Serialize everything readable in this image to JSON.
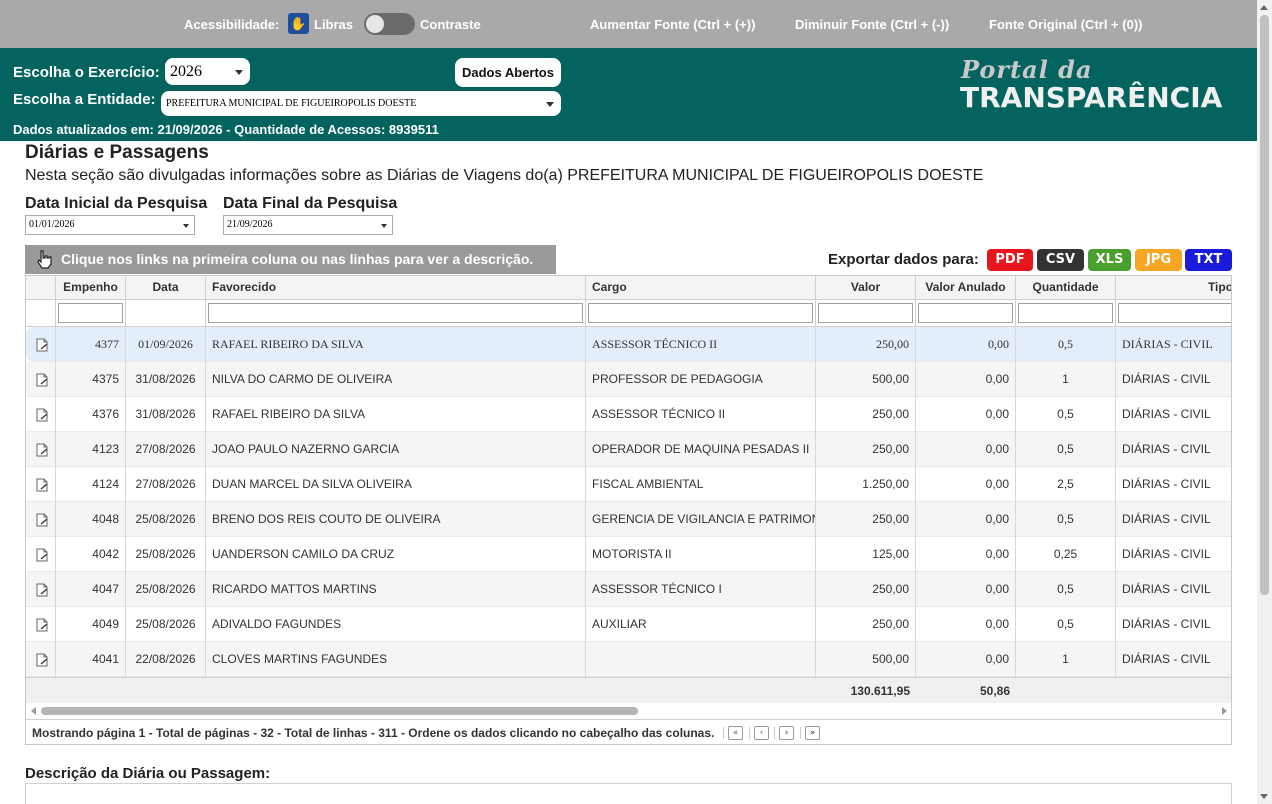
{
  "accessibility": {
    "label": "Acessibilidade:",
    "libras": "Libras",
    "contrast": "Contraste",
    "increase_font": "Aumentar Fonte (Ctrl + (+))",
    "decrease_font": "Diminuir Fonte (Ctrl + (-))",
    "original_font": "Fonte Original (Ctrl + (0))"
  },
  "header": {
    "exercise_label": "Escolha o Exercício:",
    "exercise_value": "2026",
    "entity_label": "Escolha a Entidade:",
    "entity_value": "PREFEITURA MUNICIPAL DE FIGUEIROPOLIS DOESTE",
    "open_data_button": "Dados Abertos",
    "updated_text": "Dados atualizados em: 21/09/2026 - Quantidade de Acessos: 8939511",
    "logo_line1": "Portal da",
    "logo_line2": "TRANSPARÊNCIA",
    "bg_color": "#03635f"
  },
  "page": {
    "title": "Diárias e Passagens",
    "description": "Nesta seção são divulgadas informações sobre as Diárias de Viagens do(a) PREFEITURA MUNICIPAL DE FIGUEIROPOLIS DOESTE",
    "start_date_label": "Data Inicial da Pesquisa",
    "start_date_value": "01/01/2026",
    "end_date_label": "Data Final da Pesquisa",
    "end_date_value": "21/09/2026",
    "hint": "Clique nos links na primeira coluna ou nas linhas para ver a descrição.",
    "export_label": "Exportar dados para:",
    "export": [
      {
        "label": "PDF",
        "color": "#e8161c"
      },
      {
        "label": "CSV",
        "color": "#333333"
      },
      {
        "label": "XLS",
        "color": "#4aa02c"
      },
      {
        "label": "JPG",
        "color": "#f6a623"
      },
      {
        "label": "TXT",
        "color": "#1a1adb"
      }
    ],
    "description_title": "Descrição da Diária ou Passagem:"
  },
  "grid": {
    "columns": [
      "Empenho",
      "Data",
      "Favorecido",
      "Cargo",
      "Valor",
      "Valor Anulado",
      "Quantidade",
      "Tipo"
    ],
    "rows": [
      {
        "empenho": "4377",
        "data": "01/09/2026",
        "favorecido": "RAFAEL RIBEIRO DA SILVA",
        "cargo": "ASSESSOR TÉCNICO II",
        "valor": "250,00",
        "anulado": "0,00",
        "quantidade": "0,5",
        "tipo": "DIÁRIAS - CIVIL"
      },
      {
        "empenho": "4375",
        "data": "31/08/2026",
        "favorecido": "NILVA DO CARMO DE OLIVEIRA",
        "cargo": "PROFESSOR DE PEDAGOGIA",
        "valor": "500,00",
        "anulado": "0,00",
        "quantidade": "1",
        "tipo": "DIÁRIAS - CIVIL"
      },
      {
        "empenho": "4376",
        "data": "31/08/2026",
        "favorecido": "RAFAEL RIBEIRO DA SILVA",
        "cargo": "ASSESSOR TÉCNICO II",
        "valor": "250,00",
        "anulado": "0,00",
        "quantidade": "0,5",
        "tipo": "DIÁRIAS - CIVIL"
      },
      {
        "empenho": "4123",
        "data": "27/08/2026",
        "favorecido": "JOAO PAULO NAZERNO GARCIA",
        "cargo": "OPERADOR DE MAQUINA PESADAS II",
        "valor": "250,00",
        "anulado": "0,00",
        "quantidade": "0,5",
        "tipo": "DIÁRIAS - CIVIL"
      },
      {
        "empenho": "4124",
        "data": "27/08/2026",
        "favorecido": "DUAN MARCEL DA SILVA OLIVEIRA",
        "cargo": "FISCAL AMBIENTAL",
        "valor": "1.250,00",
        "anulado": "0,00",
        "quantidade": "2,5",
        "tipo": "DIÁRIAS - CIVIL"
      },
      {
        "empenho": "4048",
        "data": "25/08/2026",
        "favorecido": "BRENO DOS REIS COUTO DE OLIVEIRA",
        "cargo": "GERENCIA DE VIGILANCIA E PATRIMONIO",
        "valor": "250,00",
        "anulado": "0,00",
        "quantidade": "0,5",
        "tipo": "DIÁRIAS - CIVIL"
      },
      {
        "empenho": "4042",
        "data": "25/08/2026",
        "favorecido": "UANDERSON CAMILO DA CRUZ",
        "cargo": "MOTORISTA II",
        "valor": "125,00",
        "anulado": "0,00",
        "quantidade": "0,25",
        "tipo": "DIÁRIAS - CIVIL"
      },
      {
        "empenho": "4047",
        "data": "25/08/2026",
        "favorecido": "RICARDO MATTOS MARTINS",
        "cargo": "ASSESSOR TÉCNICO I",
        "valor": "250,00",
        "anulado": "0,00",
        "quantidade": "0,5",
        "tipo": "DIÁRIAS - CIVIL"
      },
      {
        "empenho": "4049",
        "data": "25/08/2026",
        "favorecido": "ADIVALDO FAGUNDES",
        "cargo": "AUXILIAR",
        "valor": "250,00",
        "anulado": "0,00",
        "quantidade": "0,5",
        "tipo": "DIÁRIAS - CIVIL"
      },
      {
        "empenho": "4041",
        "data": "22/08/2026",
        "favorecido": "CLOVES MARTINS FAGUNDES",
        "cargo": "",
        "valor": "500,00",
        "anulado": "0,00",
        "quantidade": "1",
        "tipo": "DIÁRIAS - CIVIL"
      }
    ],
    "totals": {
      "valor": "130.611,95",
      "anulado": "50,86"
    },
    "pager_text": "Mostrando página 1 - Total de páginas - 32 - Total de linhas - 311 - Ordene os dados clicando no cabeçalho das colunas."
  }
}
